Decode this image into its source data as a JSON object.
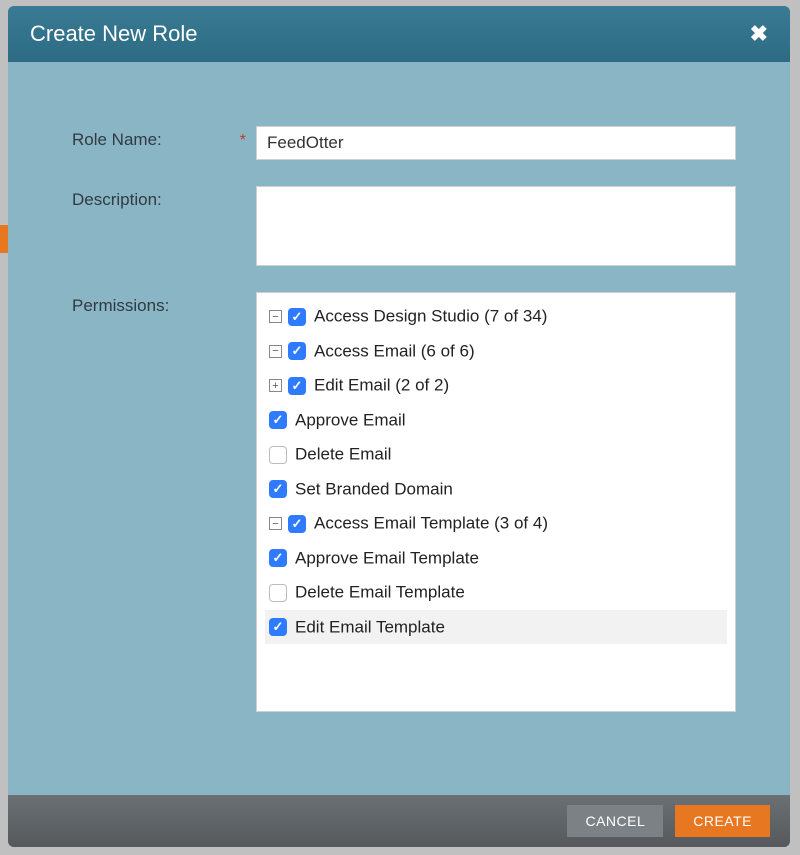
{
  "modal": {
    "title": "Create New Role",
    "labels": {
      "roleName": "Role Name:",
      "description": "Description:",
      "permissions": "Permissions:"
    },
    "roleNameValue": "FeedOtter",
    "descriptionValue": ""
  },
  "permissions": {
    "nodes": [
      {
        "level": 0,
        "toggle": "minus",
        "checked": true,
        "label": "Access Design Studio (7 of 34)",
        "highlighted": false
      },
      {
        "level": 1,
        "toggle": "minus",
        "checked": true,
        "label": "Access Email (6 of 6)",
        "highlighted": false
      },
      {
        "level": 2,
        "toggle": "plus",
        "checked": true,
        "label": "Edit Email (2 of 2)",
        "highlighted": false
      },
      {
        "level": 3,
        "toggle": "none",
        "checked": true,
        "label": "Approve Email",
        "highlighted": false
      },
      {
        "level": 3,
        "toggle": "none",
        "checked": false,
        "label": "Delete Email",
        "highlighted": false
      },
      {
        "level": 3,
        "toggle": "none",
        "checked": true,
        "label": "Set Branded Domain",
        "highlighted": false
      },
      {
        "level": 1,
        "toggle": "minus",
        "checked": true,
        "label": "Access Email Template (3 of 4)",
        "highlighted": false
      },
      {
        "level": 3,
        "toggle": "none",
        "checked": true,
        "label": "Approve Email Template",
        "highlighted": false
      },
      {
        "level": 3,
        "toggle": "none",
        "checked": false,
        "label": "Delete Email Template",
        "highlighted": false
      },
      {
        "level": 3,
        "toggle": "none",
        "checked": true,
        "label": "Edit Email Template",
        "highlighted": true
      }
    ]
  },
  "footer": {
    "cancel": "CANCEL",
    "create": "CREATE"
  },
  "glyphs": {
    "check": "✓",
    "plus": "+",
    "minus": "−",
    "close": "✖"
  }
}
